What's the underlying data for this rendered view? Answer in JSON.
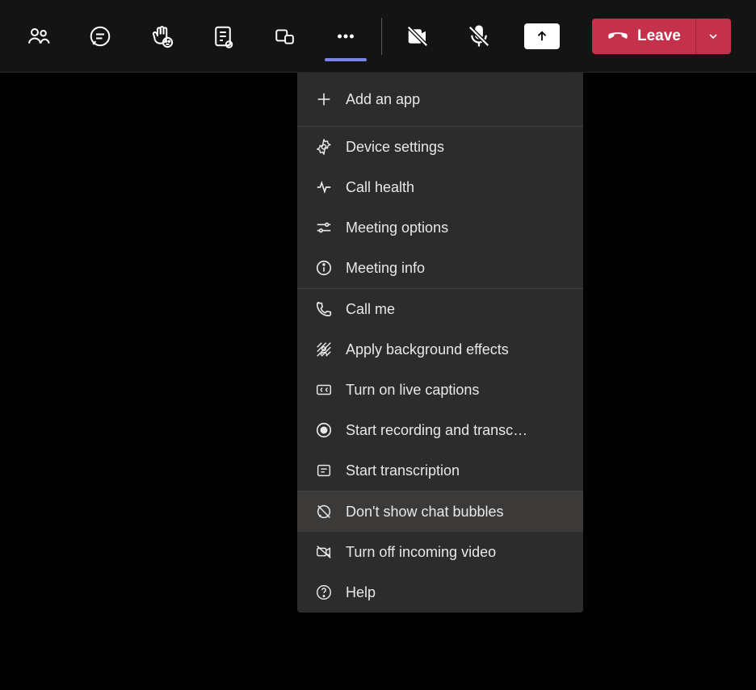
{
  "toolbar": {
    "icons": [
      {
        "name": "people-icon"
      },
      {
        "name": "chat-icon"
      },
      {
        "name": "reactions-icon"
      },
      {
        "name": "notes-icon"
      },
      {
        "name": "rooms-icon"
      },
      {
        "name": "more-icon"
      }
    ],
    "camera": "off",
    "mic": "off"
  },
  "leave": {
    "label": "Leave"
  },
  "menu": {
    "groups": [
      {
        "items": [
          {
            "name": "add-app",
            "icon": "plus-icon",
            "label": "Add an app"
          }
        ]
      },
      {
        "items": [
          {
            "name": "device-settings",
            "icon": "gear-icon",
            "label": "Device settings"
          },
          {
            "name": "call-health",
            "icon": "pulse-icon",
            "label": "Call health"
          },
          {
            "name": "meeting-options",
            "icon": "sliders-icon",
            "label": "Meeting options"
          },
          {
            "name": "meeting-info",
            "icon": "info-icon",
            "label": "Meeting info"
          }
        ]
      },
      {
        "items": [
          {
            "name": "call-me",
            "icon": "phone-icon",
            "label": "Call me"
          },
          {
            "name": "background-effects",
            "icon": "background-icon",
            "label": "Apply background effects"
          },
          {
            "name": "live-captions",
            "icon": "cc-icon",
            "label": "Turn on live captions"
          },
          {
            "name": "start-recording",
            "icon": "record-icon",
            "label": "Start recording and transc…"
          },
          {
            "name": "start-transcription",
            "icon": "transcript-icon",
            "label": "Start transcription"
          }
        ]
      },
      {
        "items": [
          {
            "name": "chat-bubbles",
            "icon": "chat-off-icon",
            "label": "Don't show chat bubbles",
            "highlighted": true
          },
          {
            "name": "incoming-video-off",
            "icon": "video-off-icon",
            "label": "Turn off incoming video"
          },
          {
            "name": "help",
            "icon": "help-icon",
            "label": "Help"
          }
        ]
      }
    ]
  }
}
